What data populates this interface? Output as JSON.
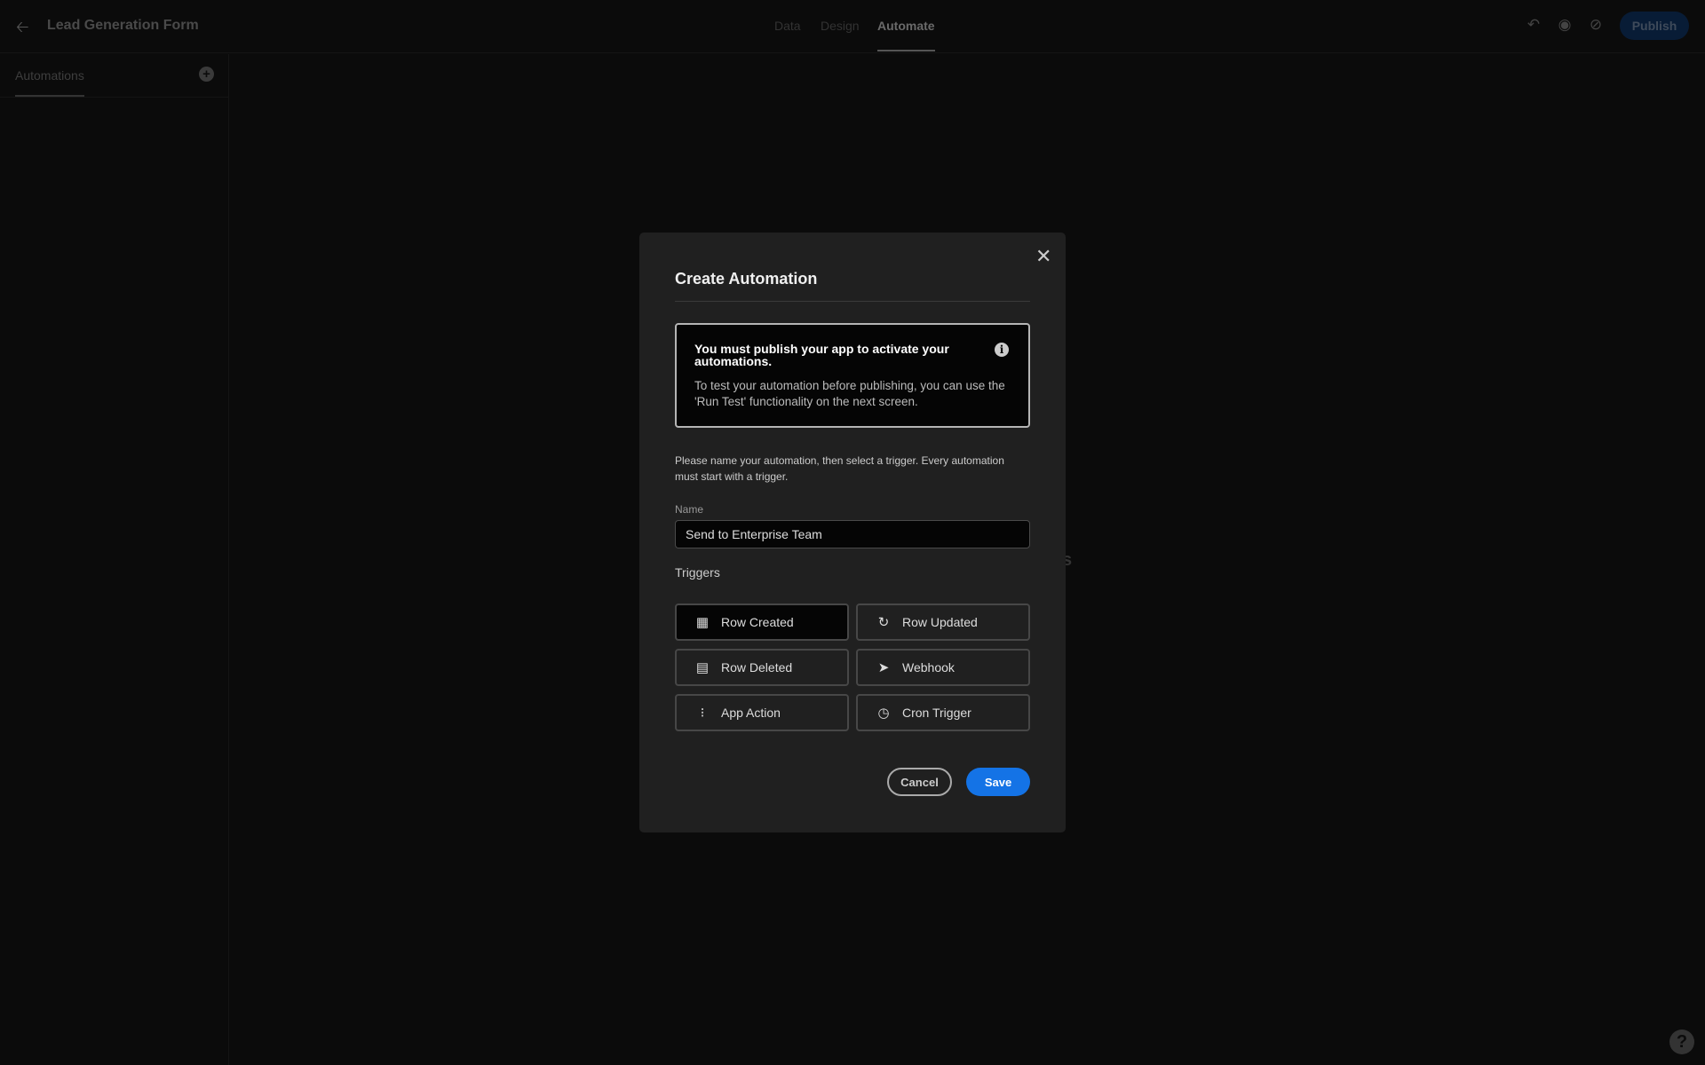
{
  "header": {
    "back_icon": "arrow-left-icon",
    "app_title": "Lead Generation Form",
    "tabs": [
      {
        "label": "Data"
      },
      {
        "label": "Design"
      },
      {
        "label": "Automate",
        "active": true
      }
    ],
    "publish_label": "Publish"
  },
  "sidebar": {
    "tab_label": "Automations"
  },
  "background_fragment": "s",
  "modal": {
    "title": "Create Automation",
    "notice": {
      "title": "You must publish your app to activate your automations.",
      "body": "To test your automation before publishing, you can use the 'Run Test' functionality on the next screen."
    },
    "description": "Please name your automation, then select a trigger. Every automation must start with a trigger.",
    "name_label": "Name",
    "name_value": "Send to Enterprise Team",
    "triggers_label": "Triggers",
    "triggers": [
      {
        "label": "Row Created",
        "icon": "table-add-icon",
        "selected": true
      },
      {
        "label": "Row Updated",
        "icon": "refresh-icon"
      },
      {
        "label": "Row Deleted",
        "icon": "table-remove-icon"
      },
      {
        "label": "Webhook",
        "icon": "paper-plane-icon"
      },
      {
        "label": "App Action",
        "icon": "dots-grid-icon"
      },
      {
        "label": "Cron Trigger",
        "icon": "clock-icon"
      }
    ],
    "cancel_label": "Cancel",
    "save_label": "Save"
  },
  "colors": {
    "accent": "#1473e6",
    "publish_bg": "#081c36",
    "background": "#0b0b0b",
    "modal_bg": "#202020"
  }
}
